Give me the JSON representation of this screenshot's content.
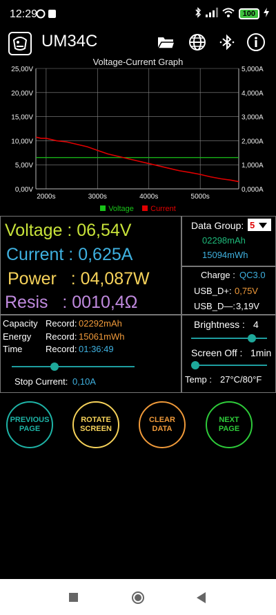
{
  "status_bar": {
    "time": "12:29",
    "battery_level": "100"
  },
  "app": {
    "title": "UM34C"
  },
  "graph": {
    "title": "Voltage-Current Graph",
    "legend": [
      {
        "name": "Voltage",
        "color": "#19c419"
      },
      {
        "name": "Current",
        "color": "#e00000"
      }
    ],
    "left_ticks": [
      "25,00V",
      "20,00V",
      "15,00V",
      "10,00V",
      "5,00V",
      "0,00V"
    ],
    "right_ticks": [
      "5,000A",
      "4,000A",
      "3,000A",
      "2,000A",
      "1,000A",
      "0,000A"
    ],
    "x_ticks": [
      "2000s",
      "3000s",
      "4000s",
      "5000s"
    ]
  },
  "chart_data": {
    "type": "line",
    "title": "Voltage-Current Graph",
    "xlabel": "",
    "ylabel": "",
    "xlim": [
      1800,
      5750
    ],
    "ylim": [
      0,
      25
    ],
    "y2lim": [
      0,
      5
    ],
    "grid": true,
    "legend": "bottom",
    "series": [
      {
        "name": "Voltage",
        "axis": "left",
        "points": [
          [
            1800,
            6.5
          ],
          [
            5750,
            6.5
          ]
        ]
      },
      {
        "name": "Current",
        "axis": "right",
        "points": [
          [
            1800,
            2.15
          ],
          [
            1900,
            2.1
          ],
          [
            2000,
            2.1
          ],
          [
            2100,
            2.05
          ],
          [
            2200,
            2.0
          ],
          [
            2400,
            1.95
          ],
          [
            2600,
            1.85
          ],
          [
            2800,
            1.75
          ],
          [
            3000,
            1.6
          ],
          [
            3200,
            1.45
          ],
          [
            3400,
            1.35
          ],
          [
            3600,
            1.25
          ],
          [
            3800,
            1.15
          ],
          [
            4000,
            1.05
          ],
          [
            4200,
            0.95
          ],
          [
            4400,
            0.85
          ],
          [
            4600,
            0.75
          ],
          [
            4800,
            0.68
          ],
          [
            5000,
            0.6
          ],
          [
            5200,
            0.5
          ],
          [
            5400,
            0.42
          ],
          [
            5600,
            0.36
          ],
          [
            5750,
            0.3
          ]
        ]
      }
    ]
  },
  "readings": {
    "voltage": "Voltage : 06,54V",
    "current": "Current : 0,625A",
    "power": "Power   : 04,087W",
    "resis": "Resis   : 0010,4Ω"
  },
  "data_group": {
    "label": "Data Group:",
    "selected": "5",
    "mah": "02298mAh",
    "mwh": "15094mWh"
  },
  "charge": {
    "charge_label": "Charge :",
    "charge_value": "QC3.0",
    "usb_dp_label": "USB_D+:",
    "usb_dp_value": "0,75V",
    "usb_dm_label": "USB_D—:",
    "usb_dm_value": "3,19V"
  },
  "record": {
    "capacity_label": "Capacity",
    "capacity_record": "Record:",
    "capacity_value": "02292mAh",
    "energy_label": "Energy",
    "energy_record": "Record:",
    "energy_value": "15061mWh",
    "time_label": "Time",
    "time_record": "Record:",
    "time_value": "01:36:49",
    "stop_current_label": "Stop Current:",
    "stop_current_value": "0,10A",
    "stop_current_slider": 0.35
  },
  "settings": {
    "brightness_label": "Brightness :",
    "brightness_value": "4",
    "brightness_slider": 0.8,
    "screen_off_label": "Screen Off :",
    "screen_off_value": "1min",
    "screen_off_slider": 0.05,
    "temp_label": "Temp :",
    "temp_value": "27°C/80°F"
  },
  "buttons": {
    "previous": "PREVIOUS\nPAGE",
    "rotate": "ROTATE\nSCREEN",
    "clear": "CLEAR\nDATA",
    "next": "NEXT\nPAGE"
  },
  "colors": {
    "voltage": "#c8e33a",
    "current": "#3fb1e0",
    "power": "#f6d25a",
    "resis": "#c08adf",
    "teal": "#1eb3a6",
    "orange": "#f09a3a"
  }
}
